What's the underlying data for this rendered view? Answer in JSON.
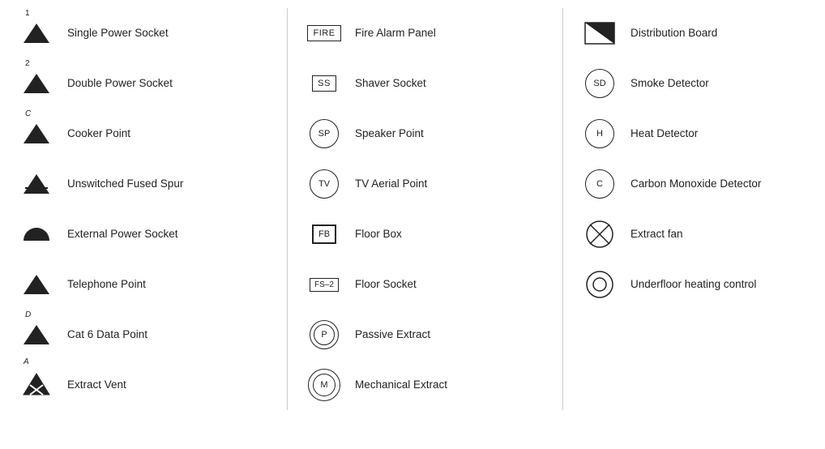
{
  "items_col1": [
    {
      "id": "single-power-socket",
      "label": "Single Power Socket",
      "symbol": "triangle-1"
    },
    {
      "id": "double-power-socket",
      "label": "Double Power Socket",
      "symbol": "triangle-2"
    },
    {
      "id": "cooker-point",
      "label": "Cooker Point",
      "symbol": "triangle-c"
    },
    {
      "id": "unswitched-fused-spur",
      "label": "Unswitched Fused Spur",
      "symbol": "triangle-notch"
    },
    {
      "id": "external-power-socket",
      "label": "External Power Socket",
      "symbol": "semicircle"
    },
    {
      "id": "telephone-point",
      "label": "Telephone Point",
      "symbol": "triangle-solid"
    },
    {
      "id": "cat6-data-point",
      "label": "Cat 6 Data Point",
      "symbol": "triangle-d"
    },
    {
      "id": "extract-vent",
      "label": "Extract Vent",
      "symbol": "extract-vent"
    }
  ],
  "items_col2": [
    {
      "id": "fire-alarm-panel",
      "label": "Fire Alarm Panel",
      "symbol": "rect-fire"
    },
    {
      "id": "shaver-socket",
      "label": "Shaver Socket",
      "symbol": "rect-ss"
    },
    {
      "id": "speaker-point",
      "label": "Speaker Point",
      "symbol": "circle-sp"
    },
    {
      "id": "tv-aerial-point",
      "label": "TV Aerial Point",
      "symbol": "circle-tv"
    },
    {
      "id": "floor-box",
      "label": "Floor Box",
      "symbol": "rect-fb"
    },
    {
      "id": "floor-socket",
      "label": "Floor Socket",
      "symbol": "rect-fs2"
    },
    {
      "id": "passive-extract",
      "label": "Passive Extract",
      "symbol": "circle-p"
    },
    {
      "id": "mechanical-extract",
      "label": "Mechanical Extract",
      "symbol": "circle-m"
    }
  ],
  "items_col3": [
    {
      "id": "distribution-board",
      "label": "Distribution Board",
      "symbol": "distribution"
    },
    {
      "id": "smoke-detector",
      "label": "Smoke Detector",
      "symbol": "circle-sd"
    },
    {
      "id": "heat-detector",
      "label": "Heat Detector",
      "symbol": "circle-h"
    },
    {
      "id": "carbon-monoxide-detector",
      "label": "Carbon Monoxide Detector",
      "symbol": "circle-c"
    },
    {
      "id": "extract-fan",
      "label": "Extract fan",
      "symbol": "circle-x"
    },
    {
      "id": "underfloor-heating-control",
      "label": "Underfloor heating control",
      "symbol": "circle-double"
    }
  ]
}
